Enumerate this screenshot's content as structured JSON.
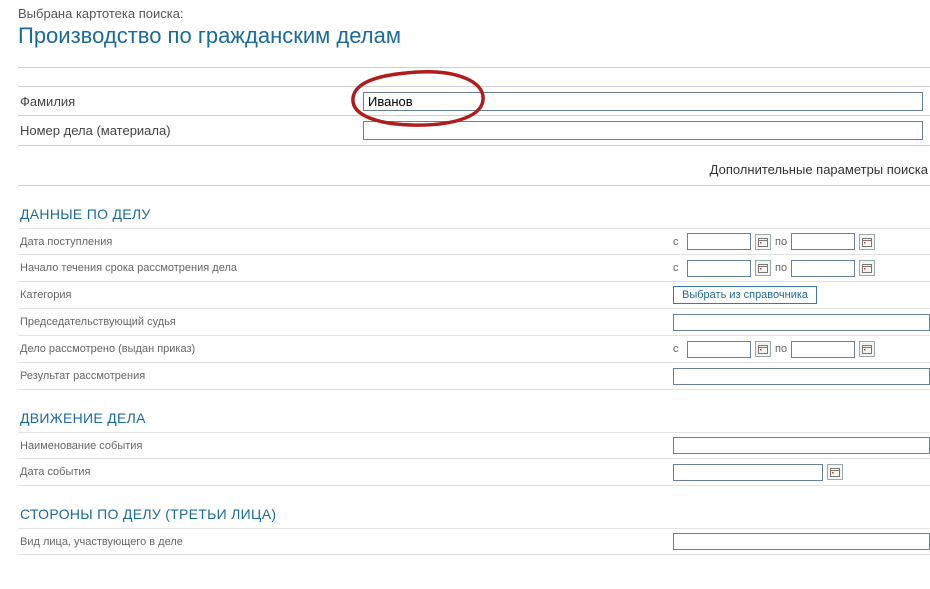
{
  "header": {
    "label": "Выбрана картотека поиска:",
    "title": "Производство по гражданским делам"
  },
  "main": {
    "surname": {
      "label": "Фамилия",
      "value": "Иванов"
    },
    "case_no": {
      "label": "Номер дела (материала)",
      "value": ""
    }
  },
  "additional_label": "Дополнительные параметры поиска",
  "range": {
    "from": "с",
    "to": "по"
  },
  "lookup_button": "Выбрать из справочника",
  "sections": {
    "case_data": {
      "title": "ДАННЫЕ ПО ДЕЛУ",
      "receipt_date": "Дата поступления",
      "start_term": "Начало течения срока рассмотрения дела",
      "category": "Категория",
      "judge": "Председательствующий судья",
      "reviewed": "Дело рассмотрено (выдан приказ)",
      "result": "Результат рассмотрения"
    },
    "movement": {
      "title": "ДВИЖЕНИЕ ДЕЛА",
      "event_name": "Наименование события",
      "event_date": "Дата события"
    },
    "parties": {
      "title": "СТОРОНЫ ПО ДЕЛУ (ТРЕТЬИ ЛИЦА)",
      "person_type": "Вид лица, участвующего в деле"
    }
  }
}
